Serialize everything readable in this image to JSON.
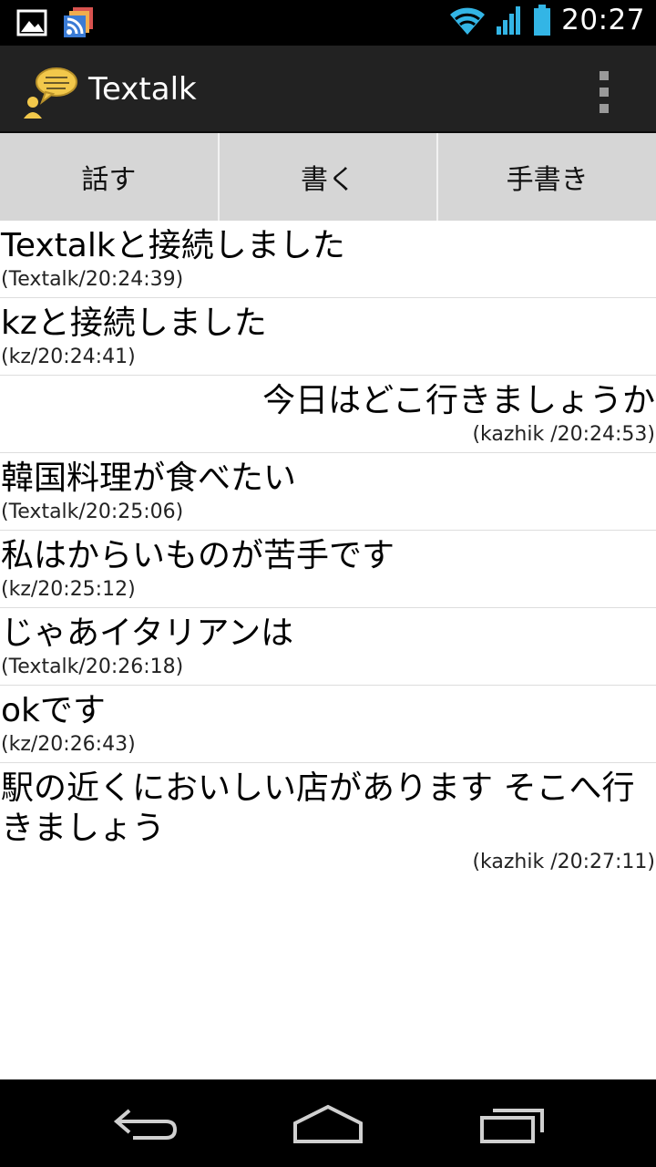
{
  "status_bar": {
    "time": "20:27",
    "left_icons": [
      "gallery-icon",
      "rss-reader-icon"
    ],
    "right_icons": [
      "wifi-icon",
      "signal-icon",
      "battery-icon"
    ]
  },
  "action_bar": {
    "title": "Textalk",
    "icon": "speech-bubble-person-icon",
    "overflow_icon": "overflow-menu-icon"
  },
  "mode_tabs": [
    "話す",
    "書く",
    "手書き"
  ],
  "messages": [
    {
      "text": "Textalkと接続しました",
      "meta": "(Textalk/20:24:39)",
      "align": "left"
    },
    {
      "text": "kzと接続しました",
      "meta": "(kz/20:24:41)",
      "align": "left"
    },
    {
      "text": "今日はどこ行きましょうか",
      "meta": "(kazhik /20:24:53)",
      "align": "right"
    },
    {
      "text": "韓国料理が食べたい",
      "meta": "(Textalk/20:25:06)",
      "align": "left"
    },
    {
      "text": "私はからいものが苦手です",
      "meta": "(kz/20:25:12)",
      "align": "left"
    },
    {
      "text": "じゃあイタリアンは",
      "meta": "(Textalk/20:26:18)",
      "align": "left"
    },
    {
      "text": "okです",
      "meta": "(kz/20:26:43)",
      "align": "left"
    },
    {
      "text": "駅の近くにおいしい店があります そこへ行きましょう",
      "meta": "(kazhik /20:27:11)",
      "align": "right"
    }
  ],
  "nav_bar": {
    "buttons": [
      "back-icon",
      "home-icon",
      "recent-apps-icon"
    ]
  },
  "colors": {
    "status_bar": "#000000",
    "action_bar": "#222222",
    "tab_bar": "#d6d6d6",
    "accent_cyan": "#33b5e5"
  }
}
